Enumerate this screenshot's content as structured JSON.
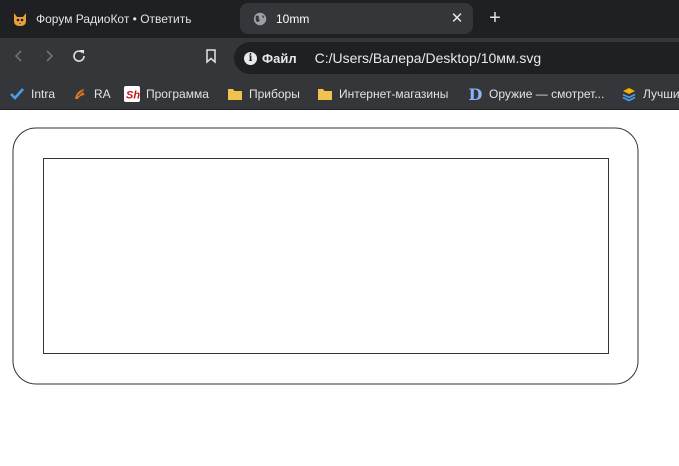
{
  "tabs": [
    {
      "title": "Форум РадиоКот • Ответить",
      "active": false,
      "icon": "cat-icon"
    },
    {
      "title": "10mm",
      "active": true,
      "icon": "globe-icon"
    }
  ],
  "toolbar": {
    "site_info_label": "Файл",
    "url": "C:/Users/Валера/Desktop/10мм.svg"
  },
  "bookmarks": [
    {
      "label": "Intra",
      "icon": "checkmark-icon"
    },
    {
      "label": "RA",
      "icon": "ra-icon"
    },
    {
      "label": "Программа",
      "icon": "sh-icon",
      "icon_text": "Sh"
    },
    {
      "label": "Приборы",
      "icon": "folder-icon"
    },
    {
      "label": "Интернет-магазины",
      "icon": "folder-icon"
    },
    {
      "label": "Оружие — смотрет...",
      "icon": "d-logo-icon",
      "icon_text": "D"
    },
    {
      "label": "Лучши",
      "icon": "stack-icon"
    }
  ],
  "colors": {
    "tabstrip": "#1f2023",
    "toolbar": "#35363a",
    "omnibox": "#1f2023",
    "text": "#e3e3e3",
    "svg_stroke": "#333333"
  }
}
